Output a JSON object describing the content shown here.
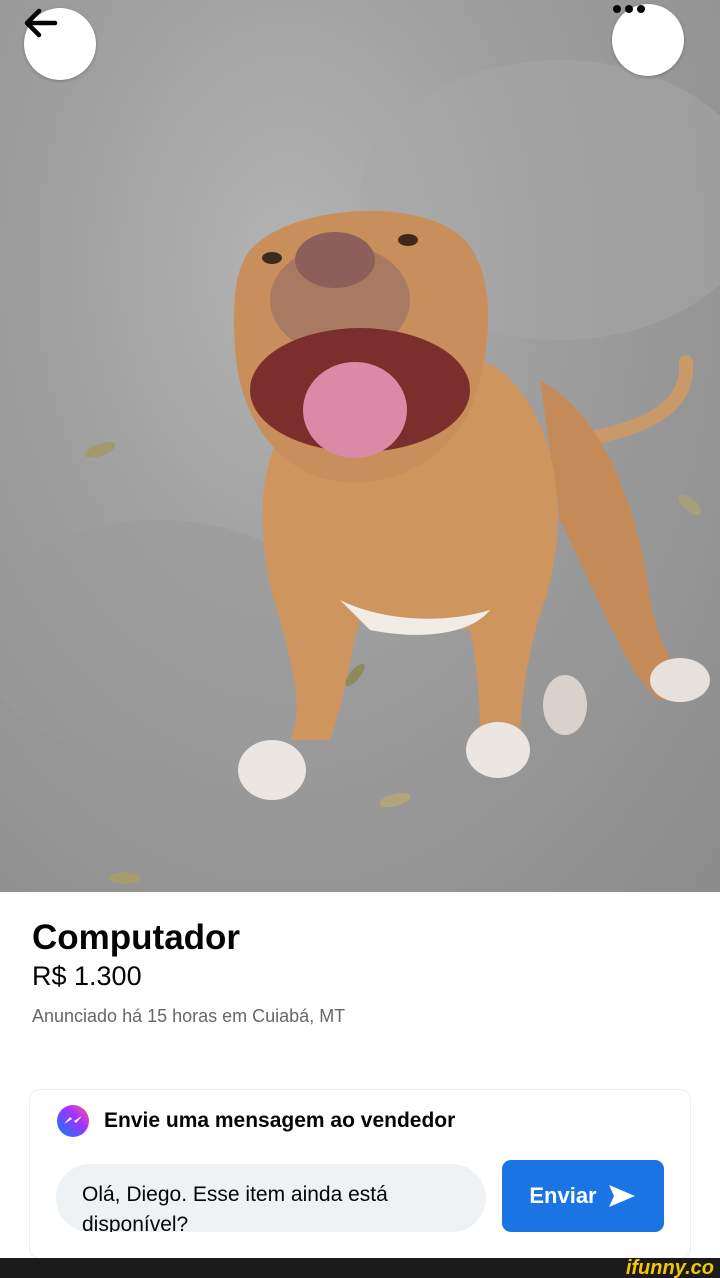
{
  "photo": {
    "alt": "dog-photo"
  },
  "nav": {
    "back_icon": "arrow-left-icon",
    "more_icon": "more-horizontal-icon"
  },
  "listing": {
    "title": "Computador",
    "price": "R$ 1.300",
    "meta": "Anunciado há 15 horas em Cuiabá, MT"
  },
  "message": {
    "heading": "Envie uma mensagem ao vendedor",
    "icon": "messenger-icon",
    "text": "Olá, Diego. Esse item ainda está disponível?",
    "send_label": "Enviar",
    "send_icon": "send-arrow-icon"
  },
  "watermark": {
    "text": "ifunny.co"
  },
  "colors": {
    "accent": "#1b74e4",
    "secondary_text": "#65676b",
    "input_bg": "#eff2f5",
    "watermark": "#f6c700"
  }
}
